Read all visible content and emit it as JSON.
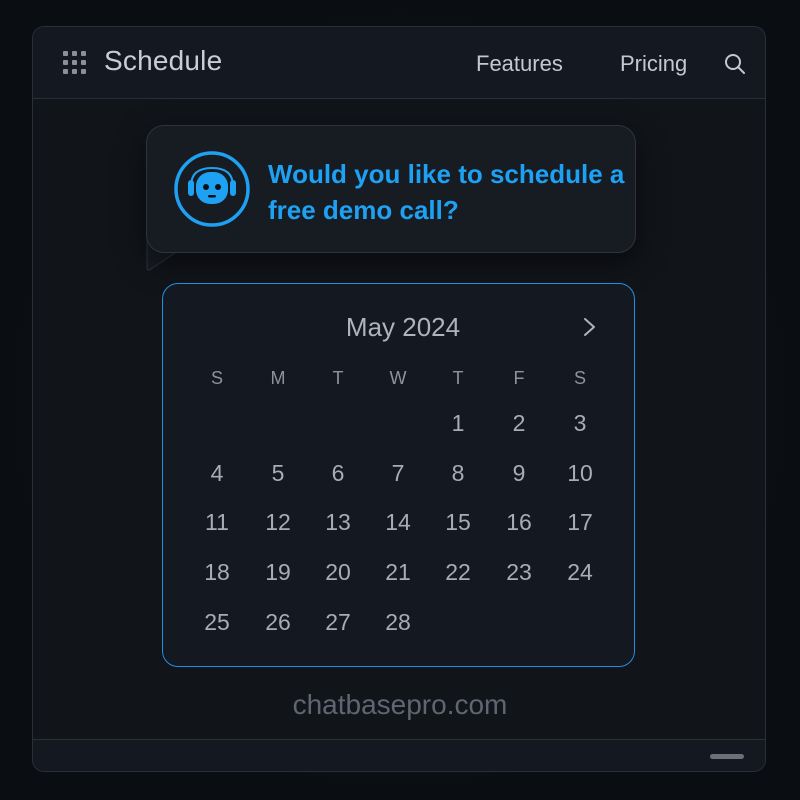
{
  "header": {
    "title": "Schedule",
    "nav": [
      {
        "label": "Features"
      },
      {
        "label": "Pricing"
      }
    ],
    "icons": {
      "menu": "grid-icon",
      "search": "search-icon"
    }
  },
  "chat": {
    "message": "Would you like to schedule a free demo call?",
    "avatar": "bot-avatar-icon",
    "accent_color": "#1ea1f2"
  },
  "calendar": {
    "month_label": "May 2024",
    "next_icon": "chevron-right-icon",
    "weekdays": [
      "S",
      "M",
      "T",
      "W",
      "T",
      "F",
      "S"
    ],
    "days": [
      "1",
      "2",
      "3",
      "4",
      "5",
      "6",
      "7",
      "8",
      "9",
      "10",
      "11",
      "12",
      "13",
      "14",
      "15",
      "16",
      "17",
      "18",
      "19",
      "20",
      "21",
      "22",
      "23",
      "24",
      "25",
      "26",
      "27",
      "28"
    ],
    "border_color": "#1f8fe0"
  },
  "footer": {
    "domain": "chatbasepro.com"
  }
}
